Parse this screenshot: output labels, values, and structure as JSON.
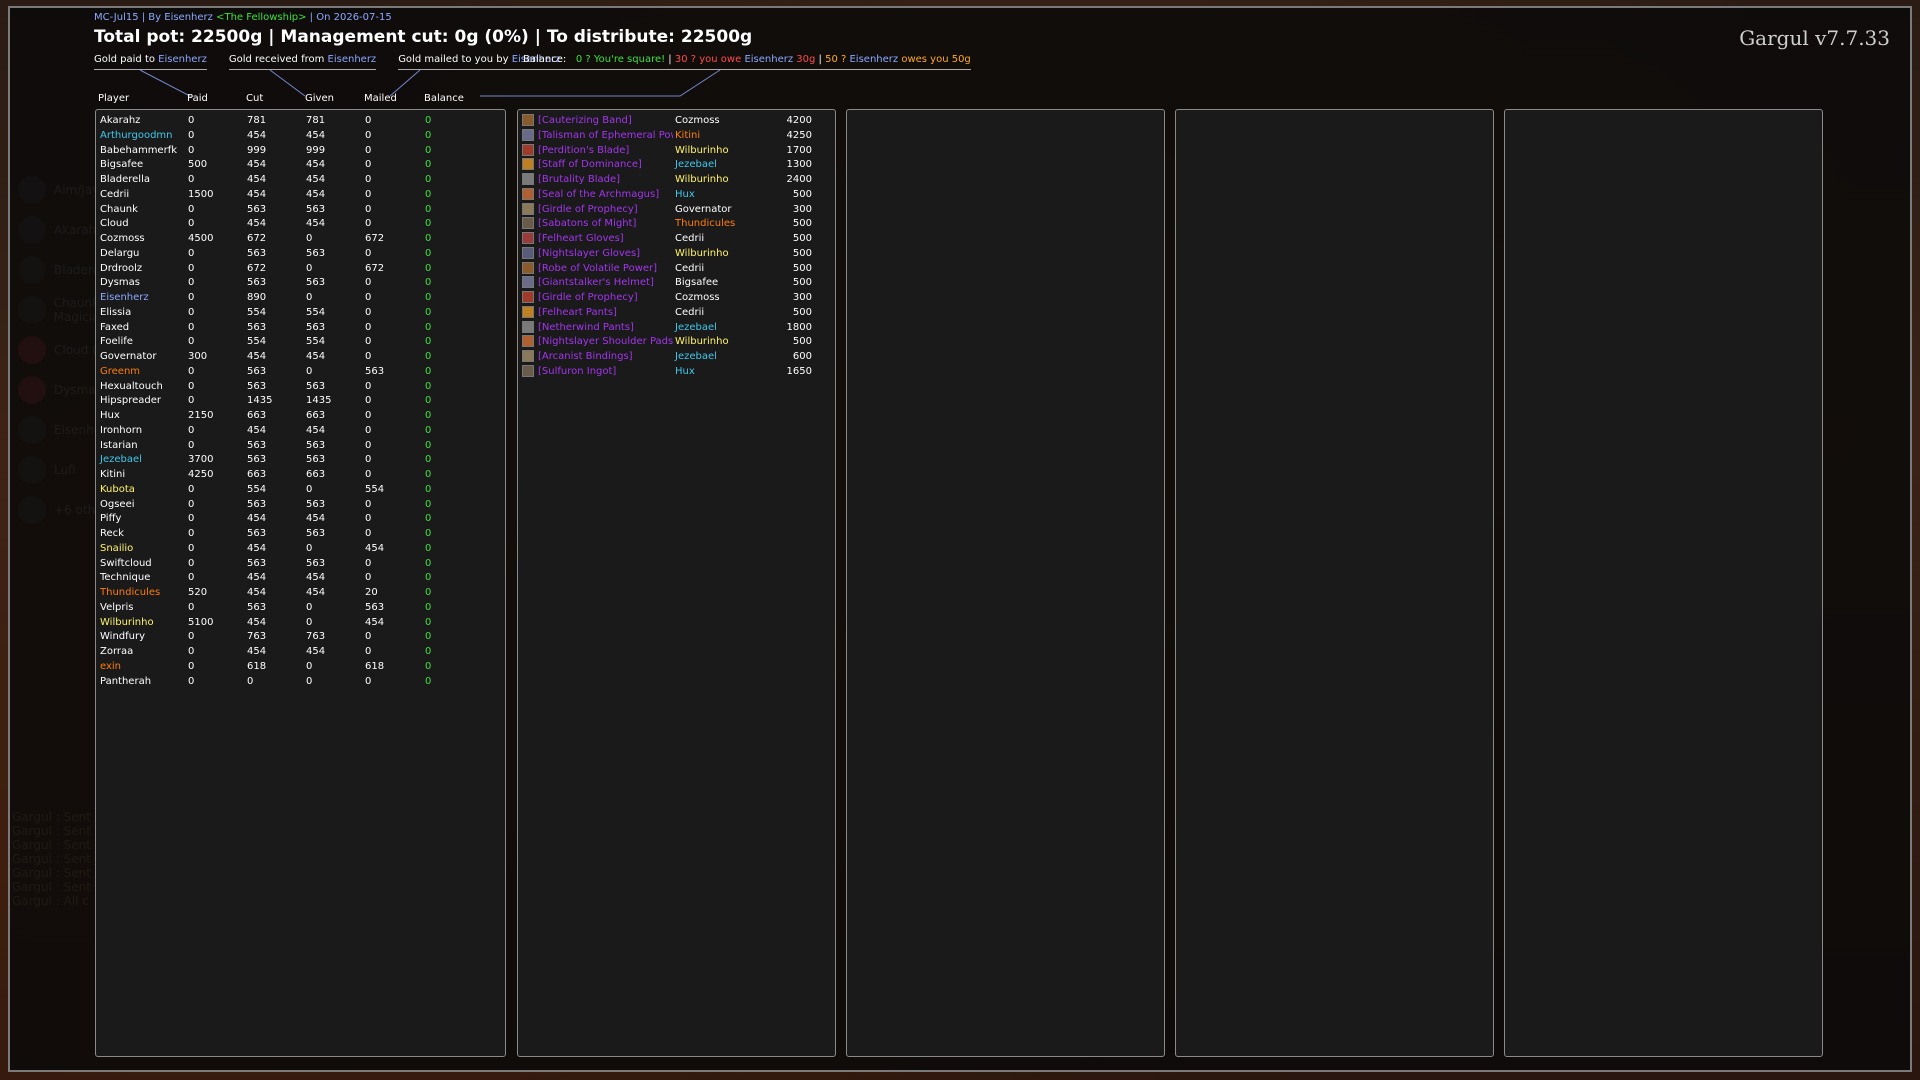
{
  "header": {
    "meta_prefix": "MC-Jul15 | By Eisenherz ",
    "meta_guild": "<The Fellowship>",
    "meta_suffix": " | On 2026-07-15",
    "title": "Total pot: 22500g | Management cut: 0g (0%) | To distribute: 22500g",
    "version": "Gargul v7.7.33"
  },
  "tabs": [
    {
      "label": "Gold paid to ",
      "name": "Eisenherz"
    },
    {
      "label": "Gold received from ",
      "name": "Eisenherz"
    },
    {
      "label": "Gold mailed to you by ",
      "name": "Eisenherz"
    }
  ],
  "balance_legend": {
    "label": "Balance:",
    "square": "0 ? You're square!",
    "sep": " | ",
    "owe_pre": "30 ? you owe ",
    "owe_name": "Eisenherz",
    "owe_amount": " 30g",
    "owed_pre": "50 ? ",
    "owed_name": "Eisenherz",
    "owed_post": " owes you 50g"
  },
  "columns": {
    "player": "Player",
    "paid": "Paid",
    "cut": "Cut",
    "given": "Given",
    "mailed": "Mailed",
    "balance": "Balance"
  },
  "colors": {
    "green": "#3fe03f",
    "blue": "#8da8ff",
    "cyan": "#3fc7eb",
    "yellow": "#fff468",
    "orange": "#ff7c0a",
    "white": "#ffffff",
    "pink": "#f48cba",
    "purple": "#a335ee",
    "accent_frame": "#8a8a8a"
  },
  "players": [
    {
      "name": "Akarahz",
      "color": "#ffffff",
      "paid": "0",
      "cut": "781",
      "given": "781",
      "mailed": "0",
      "balance": "0"
    },
    {
      "name": "Arthurgoodmn",
      "color": "#3fc7eb",
      "paid": "0",
      "cut": "454",
      "given": "454",
      "mailed": "0",
      "balance": "0"
    },
    {
      "name": "Babehammerfk",
      "color": "#ffffff",
      "paid": "0",
      "cut": "999",
      "given": "999",
      "mailed": "0",
      "balance": "0"
    },
    {
      "name": "Bigsafee",
      "color": "#ffffff",
      "paid": "500",
      "cut": "454",
      "given": "454",
      "mailed": "0",
      "balance": "0"
    },
    {
      "name": "Bladerella",
      "color": "#ffffff",
      "paid": "0",
      "cut": "454",
      "given": "454",
      "mailed": "0",
      "balance": "0"
    },
    {
      "name": "Cedrii",
      "color": "#ffffff",
      "paid": "1500",
      "cut": "454",
      "given": "454",
      "mailed": "0",
      "balance": "0"
    },
    {
      "name": "Chaunk",
      "color": "#ffffff",
      "paid": "0",
      "cut": "563",
      "given": "563",
      "mailed": "0",
      "balance": "0"
    },
    {
      "name": "Cloud",
      "color": "#ffffff",
      "paid": "0",
      "cut": "454",
      "given": "454",
      "mailed": "0",
      "balance": "0"
    },
    {
      "name": "Cozmoss",
      "color": "#ffffff",
      "paid": "4500",
      "cut": "672",
      "given": "0",
      "mailed": "672",
      "balance": "0"
    },
    {
      "name": "Delargu",
      "color": "#ffffff",
      "paid": "0",
      "cut": "563",
      "given": "563",
      "mailed": "0",
      "balance": "0"
    },
    {
      "name": "Drdroolz",
      "color": "#ffffff",
      "paid": "0",
      "cut": "672",
      "given": "0",
      "mailed": "672",
      "balance": "0"
    },
    {
      "name": "Dysmas",
      "color": "#ffffff",
      "paid": "0",
      "cut": "563",
      "given": "563",
      "mailed": "0",
      "balance": "0"
    },
    {
      "name": "Eisenherz",
      "color": "#8da8ff",
      "paid": "0",
      "cut": "890",
      "given": "0",
      "mailed": "0",
      "balance": "0"
    },
    {
      "name": "Elissia",
      "color": "#ffffff",
      "paid": "0",
      "cut": "554",
      "given": "554",
      "mailed": "0",
      "balance": "0"
    },
    {
      "name": "Faxed",
      "color": "#ffffff",
      "paid": "0",
      "cut": "563",
      "given": "563",
      "mailed": "0",
      "balance": "0"
    },
    {
      "name": "Foelife",
      "color": "#ffffff",
      "paid": "0",
      "cut": "554",
      "given": "554",
      "mailed": "0",
      "balance": "0"
    },
    {
      "name": "Governator",
      "color": "#ffffff",
      "paid": "300",
      "cut": "454",
      "given": "454",
      "mailed": "0",
      "balance": "0"
    },
    {
      "name": "Greenm",
      "color": "#ff7c0a",
      "paid": "0",
      "cut": "563",
      "given": "0",
      "mailed": "563",
      "balance": "0"
    },
    {
      "name": "Hexualtouch",
      "color": "#ffffff",
      "paid": "0",
      "cut": "563",
      "given": "563",
      "mailed": "0",
      "balance": "0"
    },
    {
      "name": "Hipspreader",
      "color": "#ffffff",
      "paid": "0",
      "cut": "1435",
      "given": "1435",
      "mailed": "0",
      "balance": "0"
    },
    {
      "name": "Hux",
      "color": "#ffffff",
      "paid": "2150",
      "cut": "663",
      "given": "663",
      "mailed": "0",
      "balance": "0"
    },
    {
      "name": "Ironhorn",
      "color": "#ffffff",
      "paid": "0",
      "cut": "454",
      "given": "454",
      "mailed": "0",
      "balance": "0"
    },
    {
      "name": "Istarian",
      "color": "#ffffff",
      "paid": "0",
      "cut": "563",
      "given": "563",
      "mailed": "0",
      "balance": "0"
    },
    {
      "name": "Jezebael",
      "color": "#3fc7eb",
      "paid": "3700",
      "cut": "563",
      "given": "563",
      "mailed": "0",
      "balance": "0"
    },
    {
      "name": "Kitini",
      "color": "#ffffff",
      "paid": "4250",
      "cut": "663",
      "given": "663",
      "mailed": "0",
      "balance": "0"
    },
    {
      "name": "Kubota",
      "color": "#fff468",
      "paid": "0",
      "cut": "554",
      "given": "0",
      "mailed": "554",
      "balance": "0"
    },
    {
      "name": "Ogseei",
      "color": "#ffffff",
      "paid": "0",
      "cut": "563",
      "given": "563",
      "mailed": "0",
      "balance": "0"
    },
    {
      "name": "Piffy",
      "color": "#ffffff",
      "paid": "0",
      "cut": "454",
      "given": "454",
      "mailed": "0",
      "balance": "0"
    },
    {
      "name": "Reck",
      "color": "#ffffff",
      "paid": "0",
      "cut": "563",
      "given": "563",
      "mailed": "0",
      "balance": "0"
    },
    {
      "name": "Snailio",
      "color": "#fff468",
      "paid": "0",
      "cut": "454",
      "given": "0",
      "mailed": "454",
      "balance": "0"
    },
    {
      "name": "Swiftcloud",
      "color": "#ffffff",
      "paid": "0",
      "cut": "563",
      "given": "563",
      "mailed": "0",
      "balance": "0"
    },
    {
      "name": "Technique",
      "color": "#ffffff",
      "paid": "0",
      "cut": "454",
      "given": "454",
      "mailed": "0",
      "balance": "0"
    },
    {
      "name": "Thundicules",
      "color": "#ff7c0a",
      "paid": "520",
      "cut": "454",
      "given": "454",
      "mailed": "20",
      "balance": "0"
    },
    {
      "name": "Velpris",
      "color": "#ffffff",
      "paid": "0",
      "cut": "563",
      "given": "0",
      "mailed": "563",
      "balance": "0"
    },
    {
      "name": "Wilburinho",
      "color": "#fff468",
      "paid": "5100",
      "cut": "454",
      "given": "0",
      "mailed": "454",
      "balance": "0"
    },
    {
      "name": "Windfury",
      "color": "#ffffff",
      "paid": "0",
      "cut": "763",
      "given": "763",
      "mailed": "0",
      "balance": "0"
    },
    {
      "name": "Zorraa",
      "color": "#ffffff",
      "paid": "0",
      "cut": "454",
      "given": "454",
      "mailed": "0",
      "balance": "0"
    },
    {
      "name": "exin",
      "color": "#ff7c0a",
      "paid": "0",
      "cut": "618",
      "given": "0",
      "mailed": "618",
      "balance": "0"
    },
    {
      "name": "Pantherah",
      "color": "#ffffff",
      "paid": "0",
      "cut": "0",
      "given": "0",
      "mailed": "0",
      "balance": "0"
    }
  ],
  "items": [
    {
      "item": "[Cauterizing Band]",
      "icon": "ring-icon",
      "winner": "Cozmoss",
      "winner_color": "#ffffff",
      "price": "4200"
    },
    {
      "item": "[Talisman of Ephemeral Pow...",
      "icon": "trinket-icon",
      "winner": "Kitini",
      "winner_color": "#ff7c0a",
      "price": "4250"
    },
    {
      "item": "[Perdition's Blade]",
      "icon": "dagger-icon",
      "winner": "Wilburinho",
      "winner_color": "#fff468",
      "price": "1700"
    },
    {
      "item": "[Staff of Dominance]",
      "icon": "staff-icon",
      "winner": "Jezebael",
      "winner_color": "#3fc7eb",
      "price": "1300"
    },
    {
      "item": "[Brutality Blade]",
      "icon": "sword-icon",
      "winner": "Wilburinho",
      "winner_color": "#fff468",
      "price": "2400"
    },
    {
      "item": "[Seal of the Archmagus]",
      "icon": "ring-icon",
      "winner": "Hux",
      "winner_color": "#3fc7eb",
      "price": "500"
    },
    {
      "item": "[Girdle of Prophecy]",
      "icon": "belt-icon",
      "winner": "Governator",
      "winner_color": "#ffffff",
      "price": "300"
    },
    {
      "item": "[Sabatons of Might]",
      "icon": "boots-icon",
      "winner": "Thundicules",
      "winner_color": "#ff7c0a",
      "price": "500"
    },
    {
      "item": "[Felheart Gloves]",
      "icon": "gloves-icon",
      "winner": "Cedrii",
      "winner_color": "#ffffff",
      "price": "500"
    },
    {
      "item": "[Nightslayer Gloves]",
      "icon": "gloves-icon",
      "winner": "Wilburinho",
      "winner_color": "#fff468",
      "price": "500"
    },
    {
      "item": "[Robe of Volatile Power]",
      "icon": "robe-icon",
      "winner": "Cedrii",
      "winner_color": "#ffffff",
      "price": "500"
    },
    {
      "item": "[Giantstalker's Helmet]",
      "icon": "helmet-icon",
      "winner": "Bigsafee",
      "winner_color": "#ffffff",
      "price": "500"
    },
    {
      "item": "[Girdle of Prophecy]",
      "icon": "belt-icon",
      "winner": "Cozmoss",
      "winner_color": "#ffffff",
      "price": "300"
    },
    {
      "item": "[Felheart Pants]",
      "icon": "pants-icon",
      "winner": "Cedrii",
      "winner_color": "#ffffff",
      "price": "500"
    },
    {
      "item": "[Netherwind Pants]",
      "icon": "pants-icon",
      "winner": "Jezebael",
      "winner_color": "#3fc7eb",
      "price": "1800"
    },
    {
      "item": "[Nightslayer Shoulder Pads]",
      "icon": "shoulder-icon",
      "winner": "Wilburinho",
      "winner_color": "#fff468",
      "price": "500"
    },
    {
      "item": "[Arcanist Bindings]",
      "icon": "bracers-icon",
      "winner": "Jezebael",
      "winner_color": "#3fc7eb",
      "price": "600"
    },
    {
      "item": "[Sulfuron Ingot]",
      "icon": "ingot-icon",
      "winner": "Hux",
      "winner_color": "#3fc7eb",
      "price": "1650"
    }
  ],
  "ghost_overlay": [
    {
      "label": "Aim/Jay Flum",
      "icon": "avatar-icon"
    },
    {
      "label": "Akarahz Maynard",
      "icon": "avatar-icon"
    },
    {
      "label": "Bladerella",
      "icon": "avatar-icon"
    },
    {
      "label": "Chaunk the Magician",
      "icon": "avatar-icon"
    },
    {
      "label": "Cloud (Drunky)",
      "icon": "discord-icon"
    },
    {
      "label": "Dysmas",
      "icon": "discord-icon"
    },
    {
      "label": "Eisenherz Wrecher",
      "icon": "avatar-icon"
    },
    {
      "label": "Lufi",
      "icon": "avatar-icon"
    },
    {
      "label": "+6 others in voice",
      "icon": "avatar-icon"
    }
  ],
  "chat_lines": [
    "Gargul : Sent",
    "Gargul : Sent",
    "Gargul : Sent",
    "Gargul : Sent",
    "Gargul : Sent",
    "Gargul : Sent",
    "Gargul : All c"
  ]
}
